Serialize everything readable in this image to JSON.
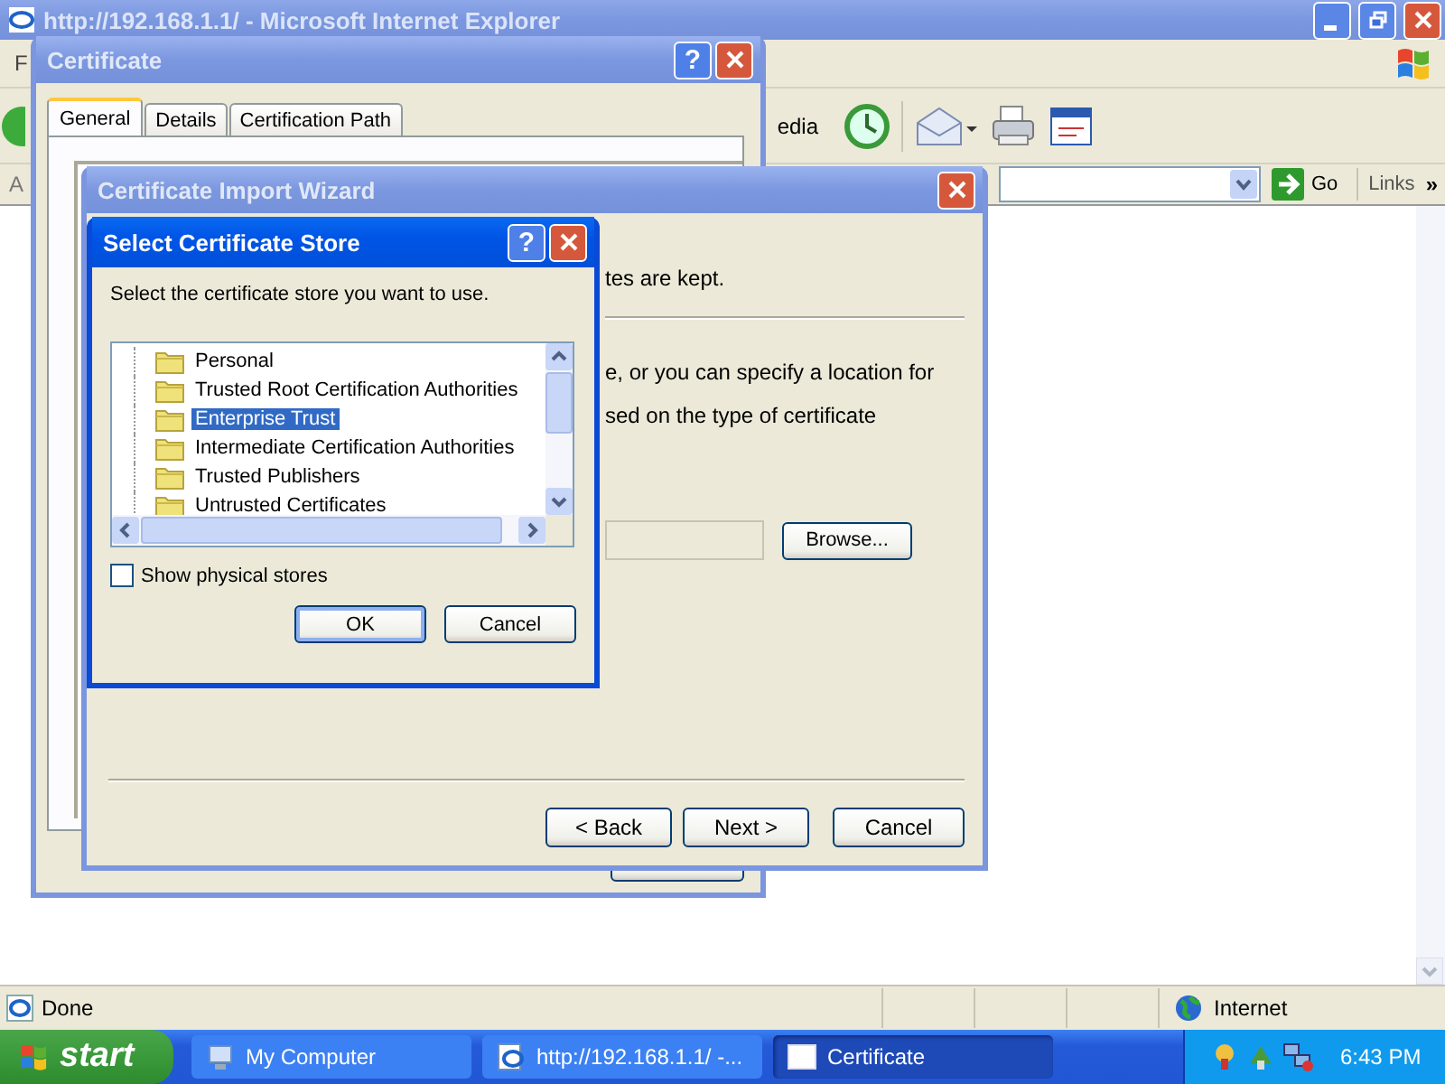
{
  "browser": {
    "title": "http://192.168.1.1/ - Microsoft Internet Explorer",
    "menu_fragment": "F",
    "toolbar_fragment": "edia",
    "address_fragment": "A",
    "go_button": "Go",
    "links_label": "Links",
    "chevron": "»",
    "status": "Done",
    "zone": "Internet"
  },
  "certificate_window": {
    "title": "Certificate",
    "help_button": "?",
    "tabs": [
      {
        "label": "General",
        "selected": true
      },
      {
        "label": "Details",
        "selected": false
      },
      {
        "label": "Certification Path",
        "selected": false
      }
    ]
  },
  "import_wizard": {
    "title": "Certificate Import Wizard",
    "text_fragments": [
      "tes are kept.",
      "e, or you can specify a location for",
      "sed on the type of certificate"
    ],
    "browse_button": "Browse...",
    "buttons": [
      "< Back",
      "Next >",
      "Cancel"
    ]
  },
  "store_dialog": {
    "title": "Select Certificate Store",
    "help_button": "?",
    "prompt": "Select the certificate store you want to use.",
    "stores": [
      {
        "name": "Personal",
        "selected": false
      },
      {
        "name": "Trusted Root Certification Authorities",
        "selected": false
      },
      {
        "name": "Enterprise Trust",
        "selected": true
      },
      {
        "name": "Intermediate Certification Authorities",
        "selected": false
      },
      {
        "name": "Trusted Publishers",
        "selected": false
      },
      {
        "name": "Untrusted Certificates",
        "selected": false
      }
    ],
    "show_physical_stores": {
      "label": "Show physical stores",
      "checked": false
    },
    "buttons": [
      "OK",
      "Cancel"
    ]
  },
  "taskbar": {
    "start": "start",
    "tasks": [
      {
        "label": "My Computer",
        "kind": "computer",
        "selected": false
      },
      {
        "label": "http://192.168.1.1/ -...",
        "kind": "browser",
        "selected": false
      },
      {
        "label": "Certificate",
        "kind": "window",
        "selected": true
      }
    ],
    "clock": "6:43 PM"
  }
}
